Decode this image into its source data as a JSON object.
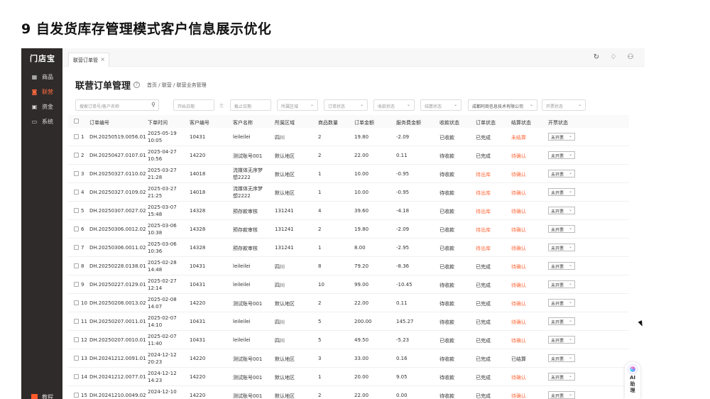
{
  "slide_title": "9 自发货库存管理模式客户信息展示优化",
  "sidebar": {
    "logo": "门店宝",
    "items": [
      {
        "label": "商品",
        "icon": "grid-icon",
        "active": false
      },
      {
        "label": "联营",
        "icon": "bag-icon",
        "active": true
      },
      {
        "label": "资金",
        "icon": "wallet-icon",
        "active": false
      },
      {
        "label": "系统",
        "icon": "monitor-icon",
        "active": false
      }
    ],
    "bottom_label": "教程"
  },
  "tab": {
    "label": "联营订单管",
    "close": "×"
  },
  "header": {
    "title": "联营订单管理",
    "help": "?",
    "breadcrumb": "首页 / 联营 / 联营业务管理"
  },
  "filters": {
    "search_placeholder": "搜索订单号/客户名称",
    "start_date": "开始日期",
    "date_sep": "至",
    "end_date": "截止日期",
    "region": "所属区域",
    "order_status": "订单状态",
    "collect_status": "收款状态",
    "settle_status": "结算状态",
    "company": "成都阿商信息技术有限公司",
    "invoice_status": "开票状态"
  },
  "table": {
    "headers": [
      "订单编号",
      "下单时间",
      "客户编号",
      "客户名称",
      "所属区域",
      "商品数量",
      "订单金额",
      "服务费金额",
      "收款状态",
      "订单状态",
      "结算状态",
      "开票状态"
    ],
    "rows": [
      {
        "idx": "1",
        "order": "DH.20250519.0056.01",
        "date": "2025-05-19",
        "time": "10:05",
        "cust_no": "10431",
        "cust_a": "leileilei",
        "cust_b": "",
        "region": "四川",
        "qty": "2",
        "amount": "19.80",
        "fee": "-2.09",
        "collect": "已收款",
        "status": "已完成",
        "settle": "未结算",
        "invoice": "未开票"
      },
      {
        "idx": "2",
        "order": "DH.20250427.0107.01",
        "date": "2025-04-27",
        "time": "10:56",
        "cust_no": "14220",
        "cust_a": "测试账号001",
        "cust_b": "",
        "region": "默认地区",
        "qty": "2",
        "amount": "22.00",
        "fee": "0.11",
        "collect": "待收款",
        "status": "已完成",
        "settle": "待确认",
        "invoice": "未开票"
      },
      {
        "idx": "3",
        "order": "DH.20250327.0110.02",
        "date": "2025-03-27",
        "time": "21:28",
        "cust_no": "14018",
        "cust_a": "流媒体无序梦",
        "cust_b": "想2222",
        "region": "默认地区",
        "qty": "1",
        "amount": "10.00",
        "fee": "-0.95",
        "collect": "待收款",
        "status": "待出库",
        "settle": "待确认",
        "invoice": "未开票"
      },
      {
        "idx": "4",
        "order": "DH.20250327.0109.02",
        "date": "2025-03-27",
        "time": "21:25",
        "cust_no": "14018",
        "cust_a": "流媒体无序梦",
        "cust_b": "想2222",
        "region": "默认地区",
        "qty": "1",
        "amount": "10.00",
        "fee": "-0.95",
        "collect": "待收款",
        "status": "待出库",
        "settle": "待确认",
        "invoice": "未开票"
      },
      {
        "idx": "5",
        "order": "DH.20250307.0027.02",
        "date": "2025-03-07",
        "time": "15:48",
        "cust_no": "14328",
        "cust_a": "预存款审核",
        "cust_b": "",
        "region": "131241",
        "qty": "4",
        "amount": "39.60",
        "fee": "-4.18",
        "collect": "已收款",
        "status": "待出库",
        "settle": "待确认",
        "invoice": "未开票"
      },
      {
        "idx": "6",
        "order": "DH.20250306.0012.02",
        "date": "2025-03-06",
        "time": "10:38",
        "cust_no": "14328",
        "cust_a": "预存款审核",
        "cust_b": "",
        "region": "131241",
        "qty": "2",
        "amount": "19.80",
        "fee": "-2.09",
        "collect": "已收款",
        "status": "待出库",
        "settle": "待确认",
        "invoice": "未开票"
      },
      {
        "idx": "7",
        "order": "DH.20250306.0011.02",
        "date": "2025-03-06",
        "time": "10:36",
        "cust_no": "14328",
        "cust_a": "预存款审核",
        "cust_b": "",
        "region": "131241",
        "qty": "1",
        "amount": "8.00",
        "fee": "-2.95",
        "collect": "已收款",
        "status": "待出库",
        "settle": "待确认",
        "invoice": "未开票"
      },
      {
        "idx": "8",
        "order": "DH.20250228.0138.01",
        "date": "2025-02-28",
        "time": "14:48",
        "cust_no": "10431",
        "cust_a": "leileilei",
        "cust_b": "",
        "region": "四川",
        "qty": "8",
        "amount": "79.20",
        "fee": "-8.36",
        "collect": "已收款",
        "status": "已完成",
        "settle": "待确认",
        "invoice": "未开票"
      },
      {
        "idx": "9",
        "order": "DH.20250227.0129.01",
        "date": "2025-02-27",
        "time": "12:14",
        "cust_no": "10431",
        "cust_a": "leileilei",
        "cust_b": "",
        "region": "四川",
        "qty": "10",
        "amount": "99.00",
        "fee": "-10.45",
        "collect": "待收款",
        "status": "已完成",
        "settle": "待确认",
        "invoice": "未开票"
      },
      {
        "idx": "10",
        "order": "DH.20250208.0013.02",
        "date": "2025-02-08",
        "time": "14:07",
        "cust_no": "14220",
        "cust_a": "测试账号001",
        "cust_b": "",
        "region": "默认地区",
        "qty": "2",
        "amount": "22.00",
        "fee": "0.11",
        "collect": "待收款",
        "status": "已完成",
        "settle": "待确认",
        "invoice": "未开票"
      },
      {
        "idx": "11",
        "order": "DH.20250207.0011.01",
        "date": "2025-02-07",
        "time": "14:10",
        "cust_no": "10431",
        "cust_a": "leileilei",
        "cust_b": "",
        "region": "四川",
        "qty": "5",
        "amount": "200.00",
        "fee": "145.27",
        "collect": "待收款",
        "status": "已完成",
        "settle": "待确认",
        "invoice": "未开票"
      },
      {
        "idx": "12",
        "order": "DH.20250207.0010.01",
        "date": "2025-02-07",
        "time": "11:40",
        "cust_no": "10431",
        "cust_a": "leileilei",
        "cust_b": "",
        "region": "四川",
        "qty": "5",
        "amount": "49.50",
        "fee": "-5.23",
        "collect": "已收款",
        "status": "已完成",
        "settle": "待确认",
        "invoice": "未开票"
      },
      {
        "idx": "13",
        "order": "DH.20241212.0091.01",
        "date": "2024-12-12",
        "time": "20:23",
        "cust_no": "14220",
        "cust_a": "测试账号001",
        "cust_b": "",
        "region": "默认地区",
        "qty": "3",
        "amount": "33.00",
        "fee": "0.16",
        "collect": "待收款",
        "status": "已完成",
        "settle": "已结算",
        "invoice": "未开票"
      },
      {
        "idx": "14",
        "order": "DH.20241212.0077.01",
        "date": "2024-12-12",
        "time": "14:23",
        "cust_no": "14220",
        "cust_a": "测试账号001",
        "cust_b": "",
        "region": "默认地区",
        "qty": "1",
        "amount": "20.00",
        "fee": "9.05",
        "collect": "待收款",
        "status": "已完成",
        "settle": "待确认",
        "invoice": "未开票"
      },
      {
        "idx": "15",
        "order": "DH.20241210.0049.02",
        "date": "2024-12-10",
        "time": "",
        "cust_no": "14220",
        "cust_a": "测试账号001",
        "cust_b": "",
        "region": "默认地区",
        "qty": "2",
        "amount": "22.00",
        "fee": "0.00",
        "collect": "待收款",
        "status": "已完成",
        "settle": "待确认",
        "invoice": "未开票"
      }
    ]
  },
  "ai_assistant": {
    "line1": "AI",
    "line2": "助",
    "line3": "理"
  },
  "colors": {
    "sidebar_bg": "#2f2b2a",
    "accent": "#ff6a3d"
  }
}
